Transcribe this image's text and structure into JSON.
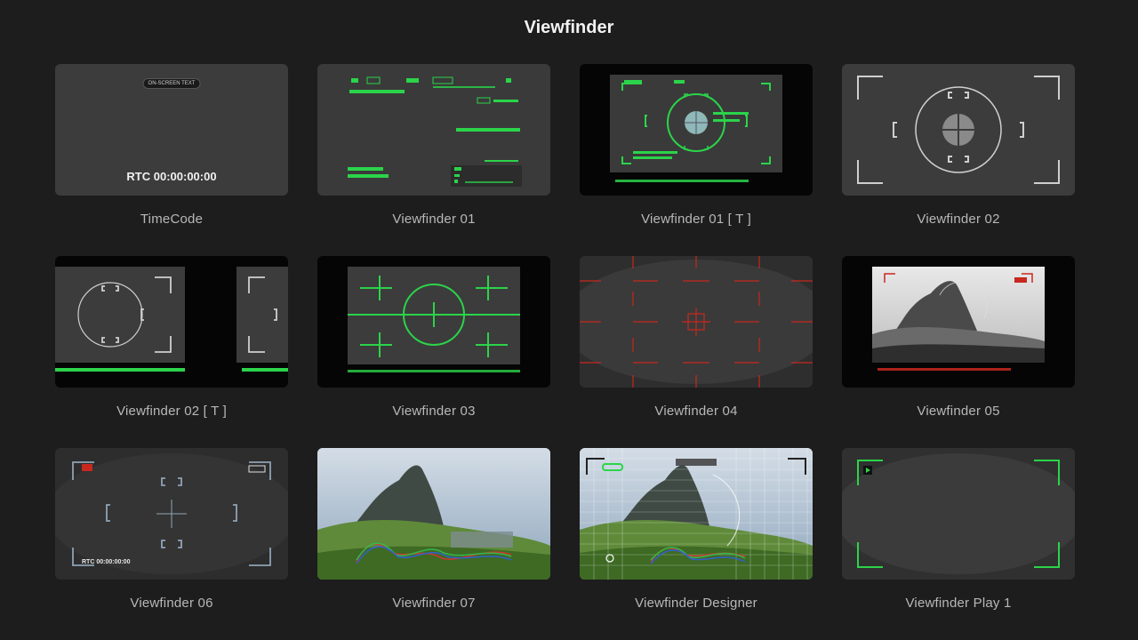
{
  "page": {
    "title": "Viewfinder"
  },
  "items": [
    {
      "label": "TimeCode",
      "badge": "ON-SCREEN TEXT",
      "timecode": "RTC 00:00:00:00"
    },
    {
      "label": "Viewfinder 01"
    },
    {
      "label": "Viewfinder 01 [ T ]"
    },
    {
      "label": "Viewfinder 02"
    },
    {
      "label": "Viewfinder 02 [ T ]"
    },
    {
      "label": "Viewfinder 03"
    },
    {
      "label": "Viewfinder 04"
    },
    {
      "label": "Viewfinder 05"
    },
    {
      "label": "Viewfinder 06",
      "timecode": "RTC 00:00:00:00"
    },
    {
      "label": "Viewfinder 07"
    },
    {
      "label": "Viewfinder Designer"
    },
    {
      "label": "Viewfinder Play 1"
    }
  ],
  "colors": {
    "background": "#1d1d1d",
    "thumb_gray": "#3a3a3a",
    "hud_green": "#2bd44a",
    "hud_red": "#c8281e",
    "hud_blue_gray": "#8fa3b5"
  }
}
